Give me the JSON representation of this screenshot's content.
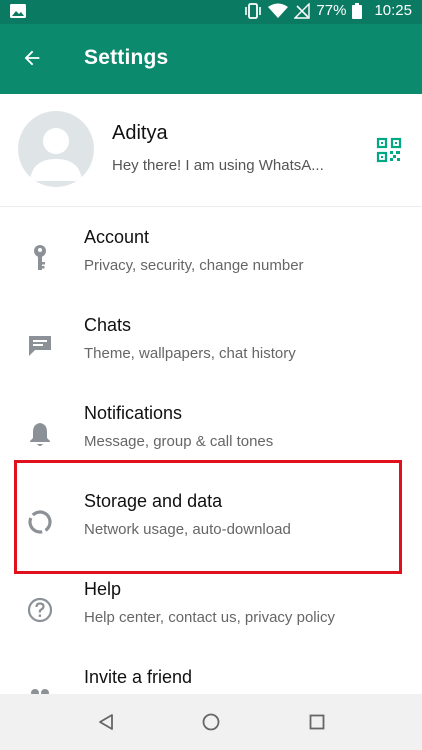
{
  "status_bar": {
    "battery": "77%",
    "time": "10:25"
  },
  "header": {
    "title": "Settings"
  },
  "profile": {
    "name": "Aditya",
    "status": "Hey there! I am using WhatsA..."
  },
  "menu": [
    {
      "label": "Account",
      "subtitle": "Privacy, security, change number",
      "icon": "key-icon"
    },
    {
      "label": "Chats",
      "subtitle": "Theme, wallpapers, chat history",
      "icon": "chat-icon"
    },
    {
      "label": "Notifications",
      "subtitle": "Message, group & call tones",
      "icon": "bell-icon"
    },
    {
      "label": "Storage and data",
      "subtitle": "Network usage, auto-download",
      "icon": "data-usage-icon"
    },
    {
      "label": "Help",
      "subtitle": "Help center, contact us, privacy policy",
      "icon": "help-icon"
    },
    {
      "label": "Invite a friend",
      "subtitle": "",
      "icon": "people-icon"
    }
  ],
  "colors": {
    "status_bar": "#0b7a62",
    "app_bar": "#0b8a6d",
    "accent": "#00a884",
    "highlight": "#e0101c"
  }
}
